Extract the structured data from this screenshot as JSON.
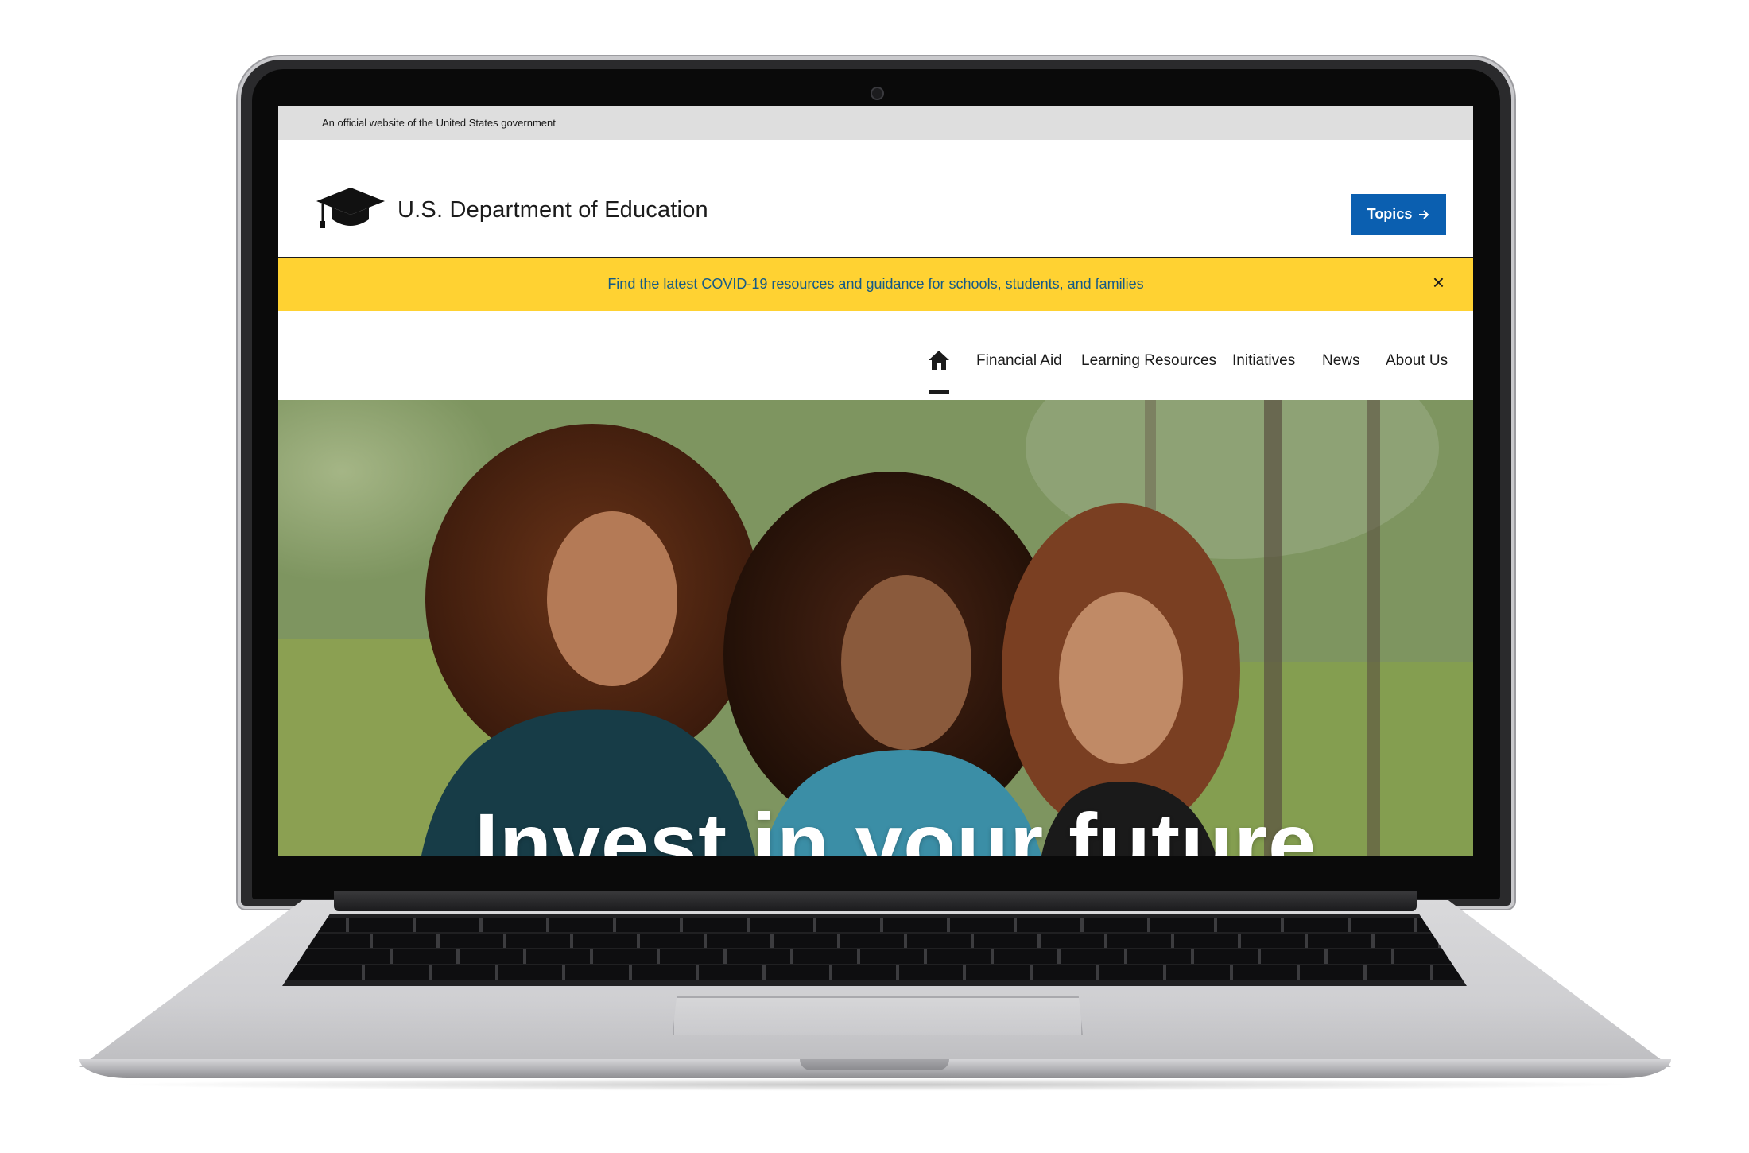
{
  "gov_banner": {
    "text": "An official website of the United States government"
  },
  "header": {
    "site_title": "U.S. Department of Education",
    "topics_label": "Topics",
    "topics_icon": "arrow-right-icon"
  },
  "alert": {
    "text": "Find the latest COVID-19 resources and guidance for schools, students, and families",
    "close_glyph": "×",
    "background": "#ffd232",
    "text_color": "#155a86"
  },
  "nav": {
    "home_icon": "home-icon",
    "items": [
      {
        "label": "Financial Aid"
      },
      {
        "label": "Learning Resources"
      },
      {
        "label": "Initiatives"
      },
      {
        "label": "News"
      },
      {
        "label": "About Us"
      }
    ]
  },
  "hero": {
    "headline": "Invest in your future"
  },
  "colors": {
    "primary": "#0b5fb0",
    "gov_banner": "#dedede",
    "text": "#1b1b1b"
  }
}
